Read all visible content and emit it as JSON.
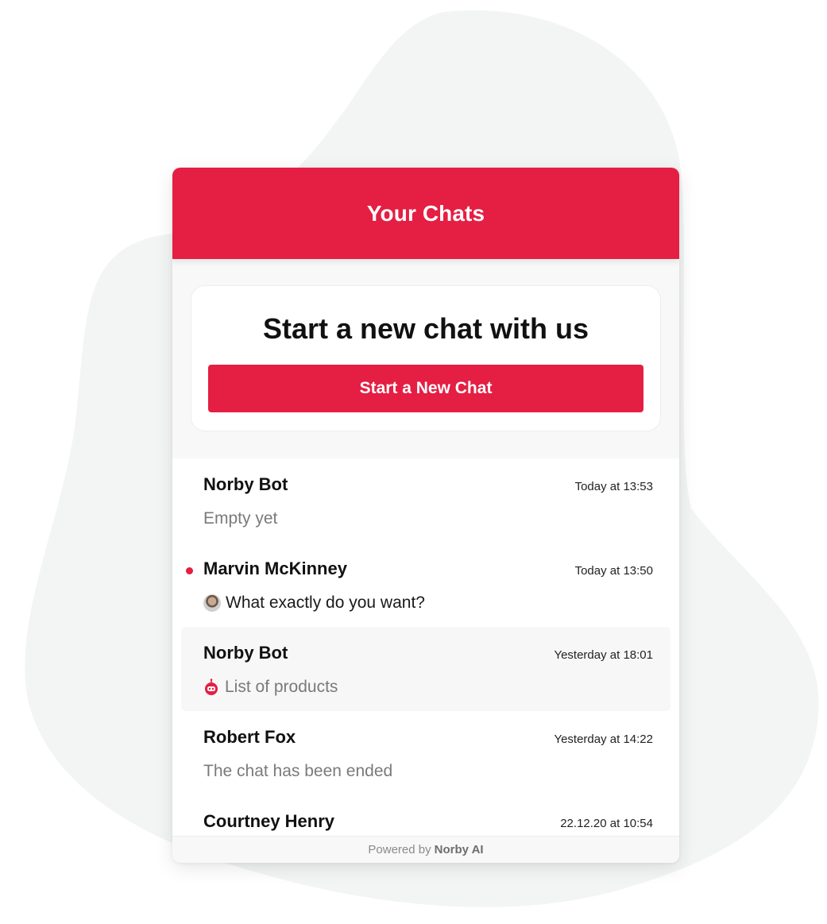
{
  "header": {
    "title": "Your Chats"
  },
  "start": {
    "heading": "Start a new chat with us",
    "button_label": "Start a New Chat"
  },
  "chats": [
    {
      "name": "Norby Bot",
      "time": "Today at 13:53",
      "preview": "Empty yet",
      "unread": false,
      "preview_icon": null,
      "highlighted": false
    },
    {
      "name": "Marvin McKinney",
      "time": "Today at 13:50",
      "preview": "What exactly do you want?",
      "unread": true,
      "preview_icon": "user-avatar",
      "highlighted": false
    },
    {
      "name": "Norby Bot",
      "time": "Yesterday at 18:01",
      "preview": "List of products",
      "unread": false,
      "preview_icon": "robot-icon",
      "highlighted": true
    },
    {
      "name": "Robert Fox",
      "time": "Yesterday at 14:22",
      "preview": "The chat has been ended",
      "unread": false,
      "preview_icon": null,
      "highlighted": false
    },
    {
      "name": "Courtney Henry",
      "time": "22.12.20 at 10:54",
      "preview": "",
      "unread": false,
      "preview_icon": null,
      "highlighted": false
    }
  ],
  "footer": {
    "prefix": "Powered by",
    "brand": "Norby AI"
  },
  "colors": {
    "accent": "#e51e43",
    "blob": "#f2f5f4"
  }
}
